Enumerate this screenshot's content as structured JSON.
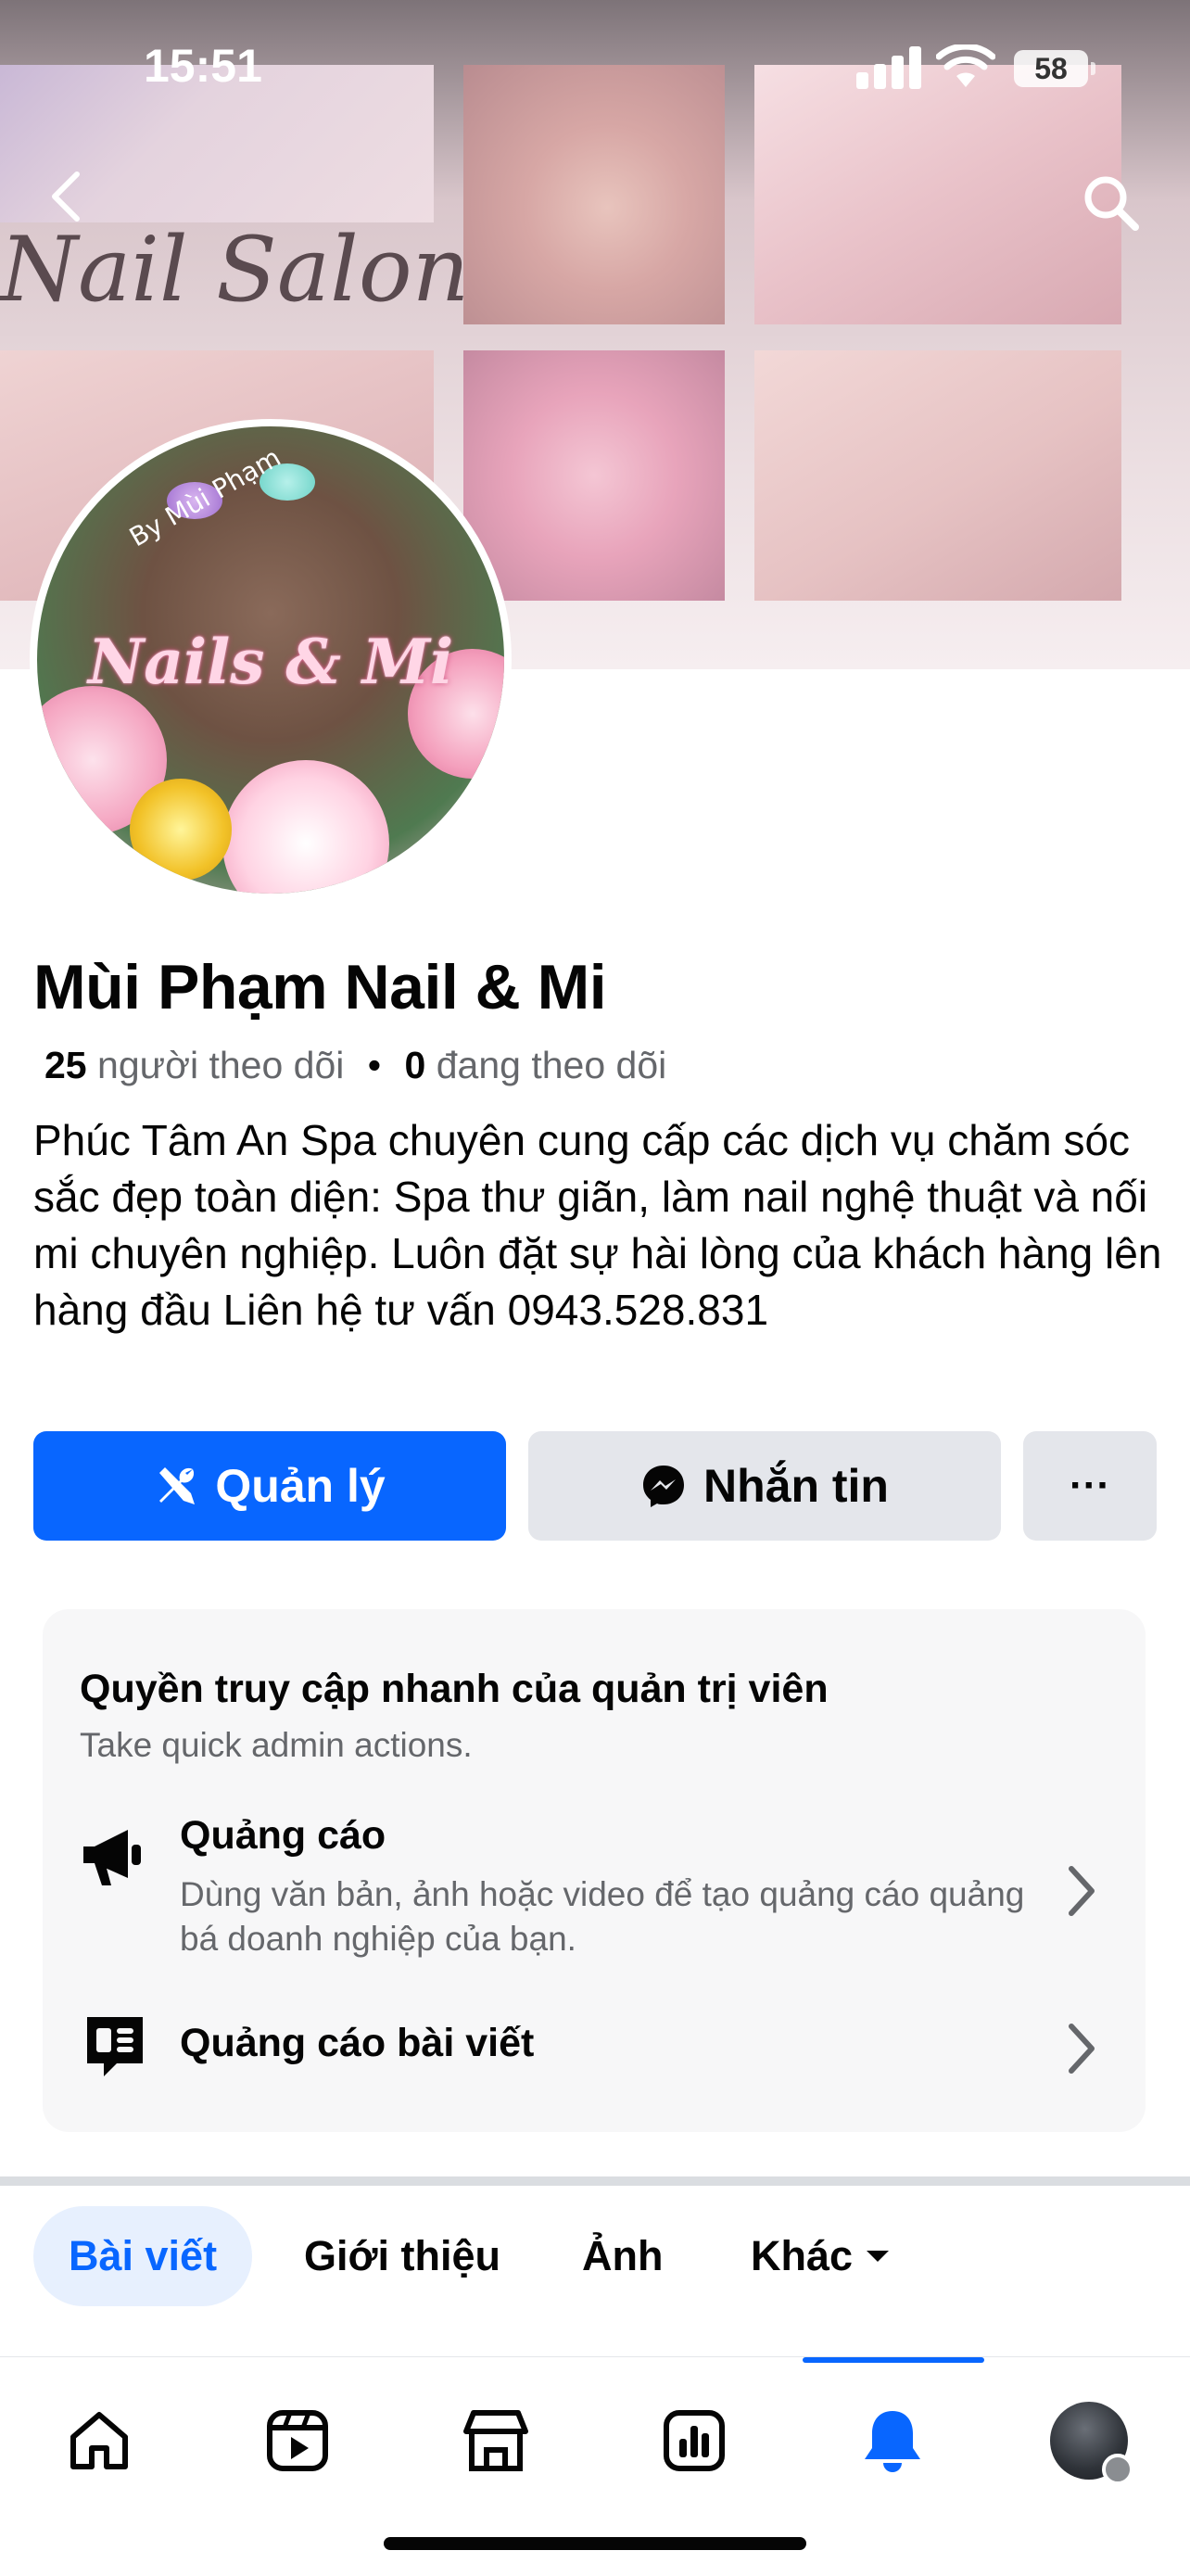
{
  "status_bar": {
    "time": "15:51",
    "battery": "58"
  },
  "cover": {
    "text": "Nail Salon"
  },
  "avatar": {
    "title": "Nails & Mi",
    "subtitle": "By Mùi Phạm"
  },
  "profile": {
    "name": "Mùi Phạm Nail & Mi",
    "followers_count": "25",
    "followers_label": "người theo dõi",
    "following_count": "0",
    "following_label": "đang theo dõi",
    "separator": "•",
    "bio": "Phúc Tâm An Spa chuyên cung cấp các dịch vụ chăm sóc sắc đẹp toàn diện: Spa thư giãn, làm nail nghệ thuật và nối mi chuyên nghiệp. Luôn đặt sự hài lòng của khách hàng lên hàng đầu  Liên hệ tư vấn 0943.528.831"
  },
  "actions": {
    "manage_label": "Quản lý",
    "message_label": "Nhắn tin",
    "more_label": "···"
  },
  "admin_card": {
    "title": "Quyền truy cập nhanh của quản trị viên",
    "subtitle": "Take quick admin actions.",
    "rows": [
      {
        "title": "Quảng cáo",
        "description": "Dùng văn bản, ảnh hoặc video để tạo quảng cáo quảng bá doanh nghiệp của bạn.",
        "icon": "megaphone-icon"
      },
      {
        "title": "Quảng cáo bài viết",
        "icon": "boost-post-icon"
      }
    ]
  },
  "tabs": [
    {
      "label": "Bài viết",
      "active": true
    },
    {
      "label": "Giới thiệu"
    },
    {
      "label": "Ảnh"
    },
    {
      "label": "Khác"
    }
  ],
  "bottom_nav": {
    "items": [
      "home-icon",
      "video-icon",
      "marketplace-icon",
      "insights-icon",
      "notifications-icon",
      "profile-avatar"
    ],
    "active": "notifications-icon"
  },
  "colors": {
    "accent": "#0866ff",
    "secondary_button": "#e4e6eb",
    "card_bg": "#f7f7f8",
    "muted_text": "#65676b"
  }
}
